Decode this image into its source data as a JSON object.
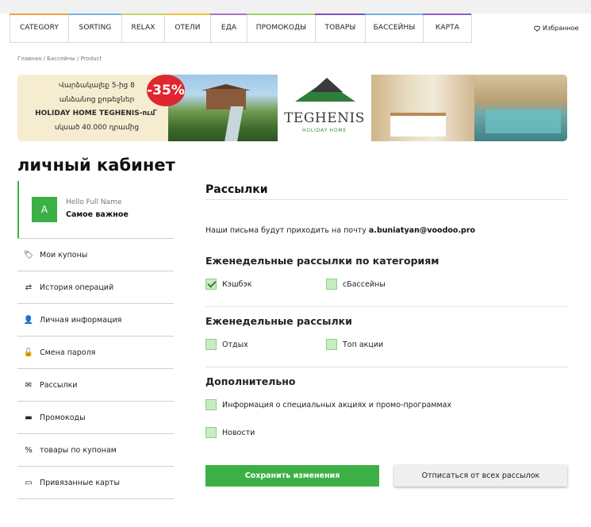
{
  "nav": {
    "items": [
      {
        "label": "CATEGORY",
        "color": "#e9a73d"
      },
      {
        "label": "SORTING",
        "color": "#7bb3e3"
      },
      {
        "label": "RELAX",
        "color": "#c5d36a"
      },
      {
        "label": "ОТЕЛИ",
        "color": "#f2c23a"
      },
      {
        "label": "ЕДА",
        "color": "#a86fc9"
      },
      {
        "label": "ПРОМОКОДЫ",
        "color": "#9fcf6b"
      },
      {
        "label": "ТОВАРЫ",
        "color": "#7b4fb5"
      },
      {
        "label": "БАССЕЙНЫ",
        "color": "#6cb2e8"
      },
      {
        "label": "КАРТА",
        "color": "#8e5fc2"
      }
    ],
    "favorites_label": "Избранное",
    "favorites_icon": "heart-icon"
  },
  "breadcrumb": "Главная / Бассейны / Product",
  "banner": {
    "lines": [
      "Վարձակալեք 5-ից 8",
      "անձանոց քոթեջներ",
      "HOLIDAY HOME TEGHENIS-ում`",
      "սկսած 40.000 դրամից"
    ],
    "discount": "-35%",
    "logo_name": "TEGHENIS",
    "logo_sub": "HOLIDAY HOME"
  },
  "page_title": "личный кабинет",
  "profile": {
    "avatar_letter": "A",
    "hello": "Hello Full Name",
    "status": "Самое важное"
  },
  "menu": [
    {
      "label": "Мои купоны",
      "icon": "tag-icon",
      "glyph": "🏷"
    },
    {
      "label": "История операций",
      "icon": "exchange-icon",
      "glyph": "⇄"
    },
    {
      "label": "Личная информация",
      "icon": "user-icon",
      "glyph": "👤"
    },
    {
      "label": "Смена пароля",
      "icon": "unlock-icon",
      "glyph": "🔓"
    },
    {
      "label": "Рассылки",
      "icon": "envelope-icon",
      "glyph": "✉"
    },
    {
      "label": "Промокоды",
      "icon": "wallet-icon",
      "glyph": "▬"
    },
    {
      "label": "товары по купонам",
      "icon": "percent-icon",
      "glyph": "%"
    },
    {
      "label": "Привязанные карты",
      "icon": "credit-card-icon",
      "glyph": "▭"
    }
  ],
  "content": {
    "section_title": "Рассылки",
    "email_prefix": "Наши письма будут приходить на почту",
    "email": "a.buniatyan@voodoo.pro",
    "groups": [
      {
        "title": "Еженедельные рассылки по категориям",
        "options": [
          {
            "label": "Кэшбэк",
            "checked": true
          },
          {
            "label": "сБассейны",
            "checked": false
          }
        ]
      },
      {
        "title": "Еженедельные рассылки",
        "options": [
          {
            "label": "Отдых",
            "checked": false
          },
          {
            "label": "Топ акции",
            "checked": false
          }
        ]
      },
      {
        "title": "Дополнительно",
        "options": [
          {
            "label": "Информация о специальных акциях и промо-программах",
            "checked": false
          },
          {
            "label": "Новости",
            "checked": false
          }
        ]
      }
    ],
    "save_label": "Сохранить изменения",
    "unsubscribe_label": "Отписаться от всех рассылок"
  },
  "colors": {
    "accent": "#3bb044",
    "checkbox_fill": "#c7ecc2"
  }
}
